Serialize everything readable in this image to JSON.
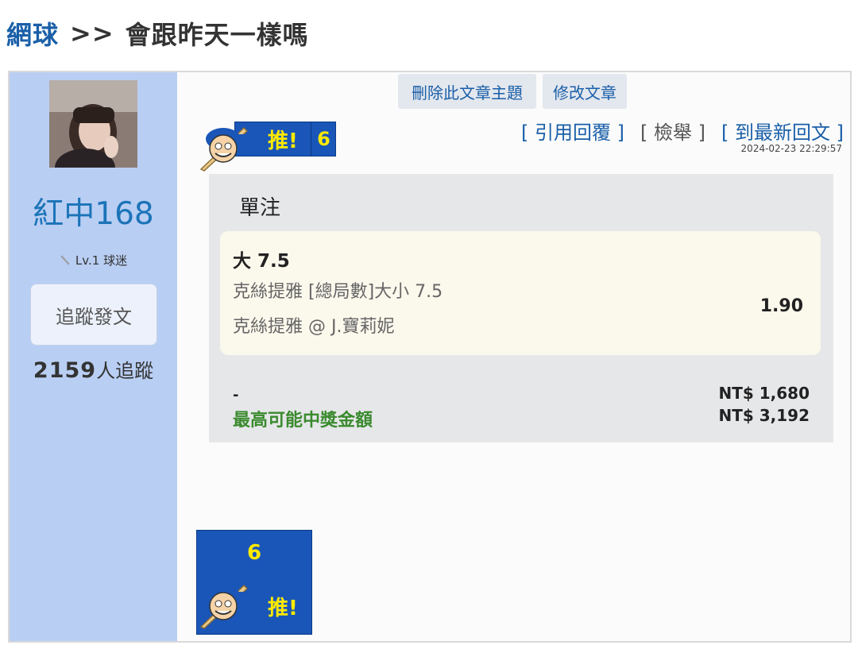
{
  "header": {
    "category": "網球",
    "separator": ">>",
    "topic": "會跟昨天一樣嗎"
  },
  "author": {
    "name": "紅中168",
    "level": "Lv.1 球迷",
    "follow_button": "追蹤發文",
    "followers_count": "2159",
    "followers_suffix": "人追蹤"
  },
  "actions": {
    "delete_topic": "刪除此文章主題",
    "edit_post": "修改文章"
  },
  "push": {
    "label": "推!",
    "count": "6"
  },
  "links": {
    "quote_reply": "[ 引用回覆 ]",
    "report": "[ 檢舉 ]",
    "latest_reply": "[ 到最新回文 ]"
  },
  "timestamp": "2024-02-23 22:29:57",
  "bet": {
    "type": "單注",
    "pick": "大 7.5",
    "market": "克絲提雅 [總局數]大小 7.5",
    "match": "克絲提雅 @ J.寶莉妮",
    "odds": "1.90",
    "stake_label": "-",
    "stake_value": "NT$ 1,680",
    "payout_label": "最高可能中獎金額",
    "payout_value": "NT$ 3,192"
  },
  "colors": {
    "sidebar": "#b9cef3",
    "link": "#1a5fa8",
    "username": "#1b74b8",
    "badge_blue": "#1a56b8",
    "badge_text": "#ffea00",
    "payout_green": "#3a8a2e"
  }
}
